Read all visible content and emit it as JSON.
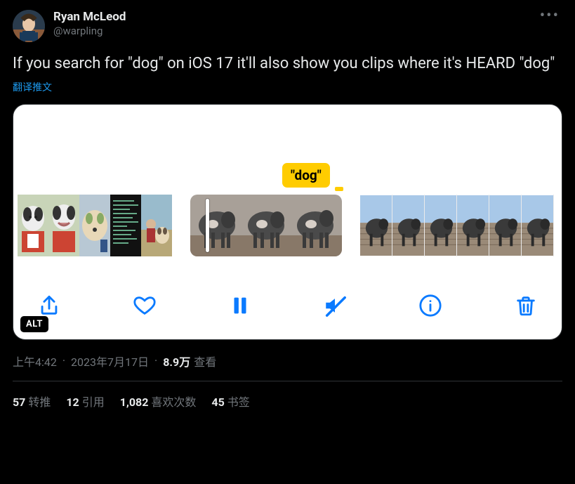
{
  "author": {
    "display_name": "Ryan McLeod",
    "handle": "@warpling"
  },
  "tweet_text": "If you search for \"dog\" on iOS 17 it'll also show you clips where it's HEARD \"dog\"",
  "translate_label": "翻译推文",
  "media": {
    "tooltip_text": "\"dog\"",
    "alt_badge": "ALT",
    "toolbar": {
      "share": "share-icon",
      "like": "heart-icon",
      "pause": "pause-icon",
      "mute": "mute-icon",
      "info": "info-icon",
      "delete": "trash-icon"
    }
  },
  "meta": {
    "time": "上午4:42",
    "date": "2023年7月17日",
    "views_number": "8.9万",
    "views_label": "查看"
  },
  "stats": {
    "retweets_num": "57",
    "retweets_label": "转推",
    "quotes_num": "12",
    "quotes_label": "引用",
    "likes_num": "1,082",
    "likes_label": "喜欢次数",
    "bookmarks_num": "45",
    "bookmarks_label": "书签"
  }
}
